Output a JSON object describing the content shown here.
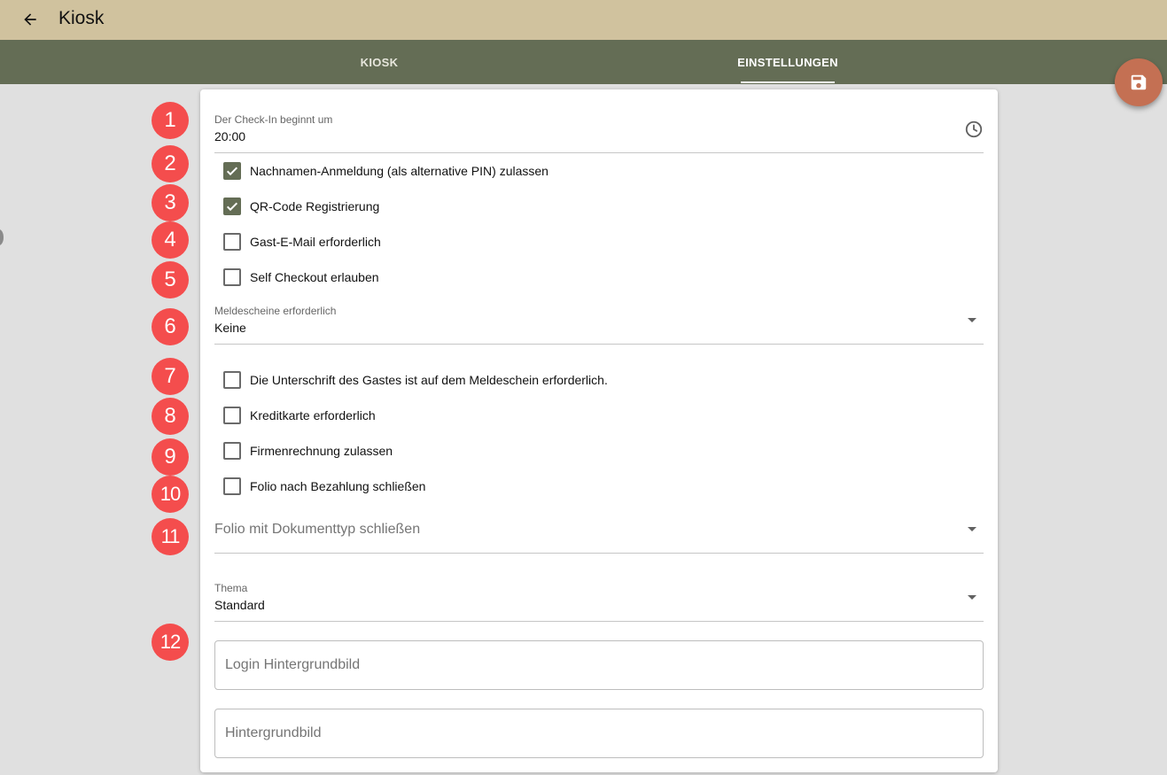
{
  "appbar": {
    "title": "Kiosk",
    "back_icon": "arrow-left-icon",
    "color": "#d0c29e"
  },
  "tabs": [
    {
      "label": "KIOSK",
      "active": false
    },
    {
      "label": "EINSTELLUNGEN",
      "active": true
    }
  ],
  "tabbar_color": "#646d55",
  "fab": {
    "icon": "save-icon",
    "color": "#c47053"
  },
  "settings": {
    "checkin": {
      "label": "Der Check-In beginnt um",
      "value": "20:00",
      "icon": "clock-icon"
    },
    "checkboxes": [
      {
        "label": "Nachnamen-Anmeldung (als alternative PIN) zulassen",
        "checked": true
      },
      {
        "label": "QR-Code Registrierung",
        "checked": true
      },
      {
        "label": "Gast-E-Mail erforderlich",
        "checked": false
      },
      {
        "label": "Self Checkout erlauben",
        "checked": false
      }
    ],
    "meldescheine": {
      "label": "Meldescheine erforderlich",
      "value": "Keine"
    },
    "checkboxes2": [
      {
        "label": "Die Unterschrift des Gastes ist auf dem Meldeschein erforderlich.",
        "checked": false
      },
      {
        "label": "Kreditkarte erforderlich",
        "checked": false
      },
      {
        "label": "Firmenrechnung zulassen",
        "checked": false
      },
      {
        "label": "Folio nach Bezahlung schließen",
        "checked": false
      }
    ],
    "folio_doctype": {
      "placeholder": "Folio mit Dokumenttyp schließen"
    },
    "theme": {
      "label": "Thema",
      "value": "Standard"
    },
    "login_background": {
      "placeholder": "Login Hintergrundbild"
    },
    "background": {
      "placeholder": "Hintergrundbild"
    }
  },
  "markers": [
    "1",
    "2",
    "3",
    "4",
    "5",
    "6",
    "7",
    "8",
    "9",
    "10",
    "11",
    "12"
  ]
}
